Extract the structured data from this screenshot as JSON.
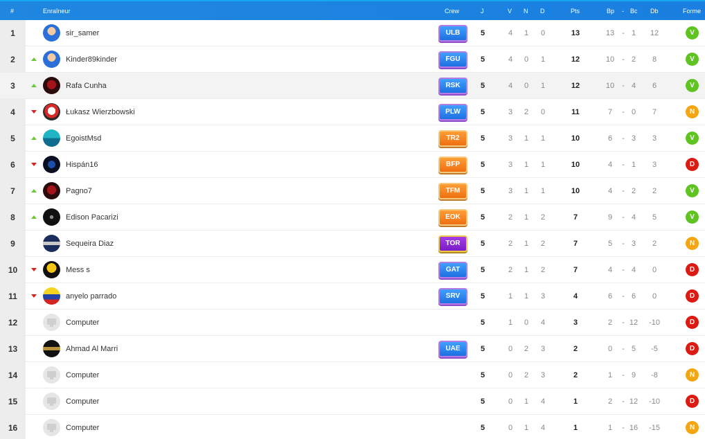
{
  "header": {
    "rank": "#",
    "trainer": "Enraîneur",
    "crew": "Crew",
    "j": "J",
    "v": "V",
    "n": "N",
    "d": "D",
    "pts": "Pts",
    "bp": "Bp",
    "dash": "-",
    "bc": "Bc",
    "db": "Db",
    "form": "Forme"
  },
  "colors": {
    "header": "#1a7fe0",
    "win": "#5fc322",
    "draw": "#f4a512",
    "loss": "#dc1a12",
    "trend_up": "#6cc832",
    "trend_down": "#d9221b"
  },
  "rows": [
    {
      "rank": "1",
      "trend": "none",
      "name": "sir_samer",
      "avatar": "cartoon-blue",
      "crew": "ULB",
      "crew_color": "blue",
      "j": "5",
      "v": "4",
      "n": "1",
      "d": "0",
      "pts": "13",
      "bp": "13",
      "dash": "-",
      "bc": "1",
      "db": "12",
      "form": "V"
    },
    {
      "rank": "2",
      "trend": "up",
      "name": "Kinder89kinder",
      "avatar": "cartoon-blue",
      "crew": "FGU",
      "crew_color": "blue",
      "j": "5",
      "v": "4",
      "n": "0",
      "d": "1",
      "pts": "12",
      "bp": "10",
      "dash": "-",
      "bc": "2",
      "db": "8",
      "form": "V"
    },
    {
      "rank": "3",
      "trend": "up",
      "name": "Rafa Cunha",
      "avatar": "dark-red",
      "crew": "RSK",
      "crew_color": "blue",
      "j": "5",
      "v": "4",
      "n": "0",
      "d": "1",
      "pts": "12",
      "bp": "10",
      "dash": "-",
      "bc": "4",
      "db": "6",
      "form": "V"
    },
    {
      "rank": "4",
      "trend": "down",
      "name": "Łukasz Wierzbowski",
      "avatar": "red-white",
      "crew": "PLW",
      "crew_color": "blue",
      "j": "5",
      "v": "3",
      "n": "2",
      "d": "0",
      "pts": "11",
      "bp": "7",
      "dash": "-",
      "bc": "0",
      "db": "7",
      "form": "N"
    },
    {
      "rank": "5",
      "trend": "up",
      "name": "EgoistMsd",
      "avatar": "teal",
      "crew": "TR2",
      "crew_color": "orange",
      "j": "5",
      "v": "3",
      "n": "1",
      "d": "1",
      "pts": "10",
      "bp": "6",
      "dash": "-",
      "bc": "3",
      "db": "3",
      "form": "V"
    },
    {
      "rank": "6",
      "trend": "down",
      "name": "Hispán16",
      "avatar": "dark-blue",
      "crew": "BFP",
      "crew_color": "orange",
      "j": "5",
      "v": "3",
      "n": "1",
      "d": "1",
      "pts": "10",
      "bp": "4",
      "dash": "-",
      "bc": "1",
      "db": "3",
      "form": "D"
    },
    {
      "rank": "7",
      "trend": "up",
      "name": "Pagno7",
      "avatar": "dark-red",
      "crew": "TFM",
      "crew_color": "orange",
      "j": "5",
      "v": "3",
      "n": "1",
      "d": "1",
      "pts": "10",
      "bp": "4",
      "dash": "-",
      "bc": "2",
      "db": "2",
      "form": "V"
    },
    {
      "rank": "8",
      "trend": "up",
      "name": "Edison Pacarizi",
      "avatar": "black",
      "crew": "EOK",
      "crew_color": "orange",
      "j": "5",
      "v": "2",
      "n": "1",
      "d": "2",
      "pts": "7",
      "bp": "9",
      "dash": "-",
      "bc": "4",
      "db": "5",
      "form": "V"
    },
    {
      "rank": "9",
      "trend": "none",
      "name": "Sequeira Diaz",
      "avatar": "navy",
      "crew": "TOR",
      "crew_color": "purple",
      "j": "5",
      "v": "2",
      "n": "1",
      "d": "2",
      "pts": "7",
      "bp": "5",
      "dash": "-",
      "bc": "3",
      "db": "2",
      "form": "N"
    },
    {
      "rank": "10",
      "trend": "down",
      "name": "Mess s",
      "avatar": "yellow-black",
      "crew": "GAT",
      "crew_color": "blue",
      "j": "5",
      "v": "2",
      "n": "1",
      "d": "2",
      "pts": "7",
      "bp": "4",
      "dash": "-",
      "bc": "4",
      "db": "0",
      "form": "D"
    },
    {
      "rank": "11",
      "trend": "down",
      "name": "anyelo parrado",
      "avatar": "flag",
      "crew": "SRV",
      "crew_color": "blue",
      "j": "5",
      "v": "1",
      "n": "1",
      "d": "3",
      "pts": "4",
      "bp": "6",
      "dash": "-",
      "bc": "6",
      "db": "0",
      "form": "D"
    },
    {
      "rank": "12",
      "trend": "none",
      "name": "Computer",
      "avatar": "computer",
      "crew": "",
      "crew_color": "",
      "j": "5",
      "v": "1",
      "n": "0",
      "d": "4",
      "pts": "3",
      "bp": "2",
      "dash": "-",
      "bc": "12",
      "db": "-10",
      "form": "D"
    },
    {
      "rank": "13",
      "trend": "none",
      "name": "Ahmad Al Marri",
      "avatar": "gold-black",
      "crew": "UAE",
      "crew_color": "blue",
      "j": "5",
      "v": "0",
      "n": "2",
      "d": "3",
      "pts": "2",
      "bp": "0",
      "dash": "-",
      "bc": "5",
      "db": "-5",
      "form": "D"
    },
    {
      "rank": "14",
      "trend": "none",
      "name": "Computer",
      "avatar": "computer",
      "crew": "",
      "crew_color": "",
      "j": "5",
      "v": "0",
      "n": "2",
      "d": "3",
      "pts": "2",
      "bp": "1",
      "dash": "-",
      "bc": "9",
      "db": "-8",
      "form": "N"
    },
    {
      "rank": "15",
      "trend": "none",
      "name": "Computer",
      "avatar": "computer",
      "crew": "",
      "crew_color": "",
      "j": "5",
      "v": "0",
      "n": "1",
      "d": "4",
      "pts": "1",
      "bp": "2",
      "dash": "-",
      "bc": "12",
      "db": "-10",
      "form": "D"
    },
    {
      "rank": "16",
      "trend": "none",
      "name": "Computer",
      "avatar": "computer",
      "crew": "",
      "crew_color": "",
      "j": "5",
      "v": "0",
      "n": "1",
      "d": "4",
      "pts": "1",
      "bp": "1",
      "dash": "-",
      "bc": "16",
      "db": "-15",
      "form": "N"
    }
  ]
}
